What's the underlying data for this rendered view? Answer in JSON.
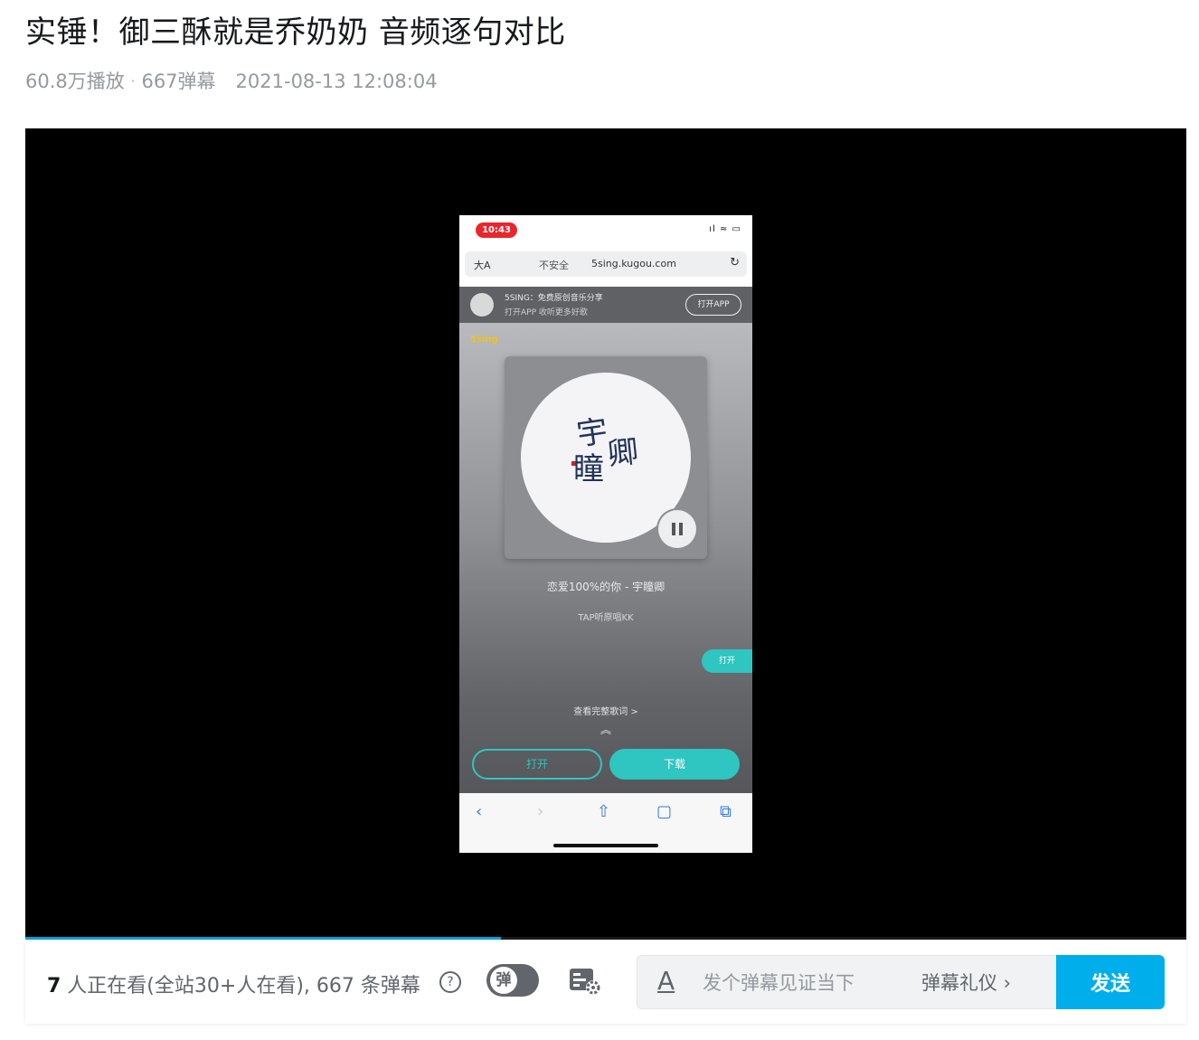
{
  "video": {
    "title": "实锤！御三酥就是乔奶奶 音频逐句对比",
    "views": "60.8万播放",
    "danmaku_count": "667弹幕",
    "date": "2021-08-13 12:08:04",
    "progress": 0.41
  },
  "phone": {
    "time": "10:43",
    "sys_icons": "ıl ≈ ▭",
    "url_aa": "大A",
    "url_secure": "不安全",
    "url": "5sing.kugou.com",
    "reload": "↻",
    "banner_line1": "5SING：免费原创音乐分享",
    "banner_line2": "打开APP 收听更多好歌",
    "banner_open": "打开APP",
    "brand": "5sing",
    "calli_1": "宇",
    "calli_2": "瞳",
    "calli_3": "卿",
    "song_title": "恋爱100%的你 - 宇瞳卿",
    "song_sub": "TAP听原唱KK",
    "side_pill": "打开",
    "lyrics_link": "查看完整歌词 >",
    "chev": "︽",
    "btn_open": "打开",
    "btn_download": "下载",
    "nav_back": "‹",
    "nav_forward": "›",
    "nav_share": "⇧",
    "nav_book": "▢",
    "nav_tabs": "⧉"
  },
  "bar": {
    "viewers_num": "7",
    "viewers_text": " 人正在看(全站30+人在看), 667 条弹幕",
    "help": "?",
    "toggle_label": "弹",
    "input_placeholder": "发个弹幕见证当下",
    "a_icon": "A",
    "etiquette": "弹幕礼仪 ›",
    "send": "发送"
  }
}
